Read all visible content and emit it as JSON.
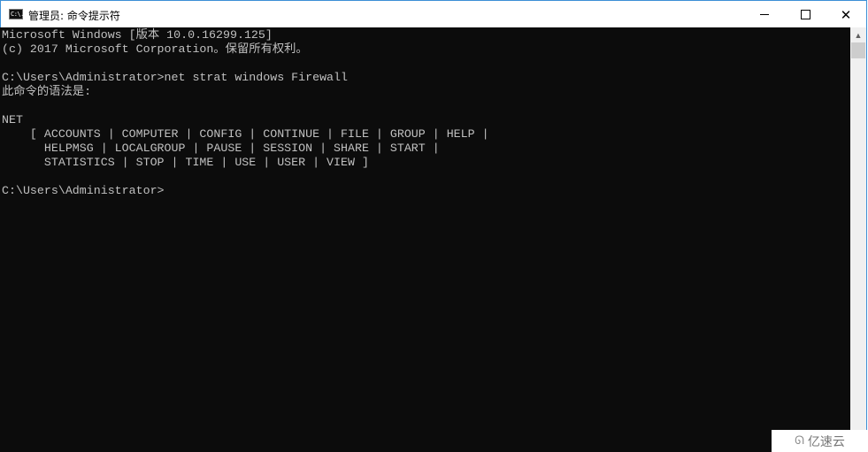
{
  "window": {
    "title": "管理员: 命令提示符",
    "app_icon": "cmd-icon",
    "app_icon_text": "C:\\.",
    "controls": {
      "minimize": "minimize-icon",
      "maximize": "maximize-icon",
      "close_glyph": "✕"
    }
  },
  "console": {
    "lines": [
      "Microsoft Windows [版本 10.0.16299.125]",
      "(c) 2017 Microsoft Corporation。保留所有权利。",
      "",
      "C:\\Users\\Administrator>net strat windows Firewall",
      "此命令的语法是:",
      "",
      "NET",
      "    [ ACCOUNTS | COMPUTER | CONFIG | CONTINUE | FILE | GROUP | HELP |",
      "      HELPMSG | LOCALGROUP | PAUSE | SESSION | SHARE | START |",
      "      STATISTICS | STOP | TIME | USE | USER | VIEW ]",
      "",
      "C:\\Users\\Administrator>"
    ]
  },
  "scrollbar": {
    "up_arrow": "▲"
  },
  "watermark": {
    "logo": "ᘏ",
    "text": "亿速云"
  }
}
